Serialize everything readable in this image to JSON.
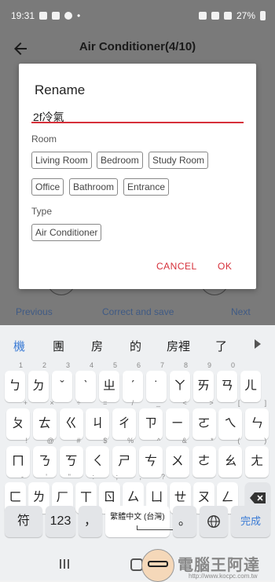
{
  "statusbar": {
    "time": "19:31",
    "battery": "27%"
  },
  "appbar": {
    "title": "Air Conditioner(4/10)"
  },
  "background_nav": {
    "previous": "Previous",
    "correct_save": "Correct and save",
    "next": "Next"
  },
  "dialog": {
    "title": "Rename",
    "input_value": "2f冷氣",
    "room_label": "Room",
    "rooms": [
      "Living Room",
      "Bedroom",
      "Study Room",
      "Office",
      "Bathroom",
      "Entrance"
    ],
    "type_label": "Type",
    "types": [
      "Air Conditioner"
    ],
    "cancel": "CANCEL",
    "ok": "OK"
  },
  "keyboard": {
    "candidates": [
      "機",
      "團",
      "房",
      "的",
      "房裡",
      "了"
    ],
    "row1": [
      {
        "k": "ㄅ",
        "h": "1"
      },
      {
        "k": "ㄉ",
        "h": "2"
      },
      {
        "k": "ˇ",
        "h": "3"
      },
      {
        "k": "ˋ",
        "h": "4"
      },
      {
        "k": "ㄓ",
        "h": "5"
      },
      {
        "k": "ˊ",
        "h": "6"
      },
      {
        "k": "˙",
        "h": "7"
      },
      {
        "k": "ㄚ",
        "h": "8"
      },
      {
        "k": "ㄞ",
        "h": "9"
      },
      {
        "k": "ㄢ",
        "h": "0"
      },
      {
        "k": "ㄦ",
        "h": ""
      }
    ],
    "row2": [
      {
        "k": "ㄆ",
        "h": "+"
      },
      {
        "k": "ㄊ",
        "h": "×"
      },
      {
        "k": "ㄍ",
        "h": "÷"
      },
      {
        "k": "ㄐ",
        "h": "="
      },
      {
        "k": "ㄔ",
        "h": "/"
      },
      {
        "k": "ㄗ",
        "h": "_"
      },
      {
        "k": "ㄧ",
        "h": "<"
      },
      {
        "k": "ㄛ",
        "h": ">"
      },
      {
        "k": "ㄟ",
        "h": "["
      },
      {
        "k": "ㄣ",
        "h": "]"
      }
    ],
    "row3": [
      {
        "k": "ㄇ",
        "h": "!"
      },
      {
        "k": "ㄋ",
        "h": "@"
      },
      {
        "k": "ㄎ",
        "h": "#"
      },
      {
        "k": "ㄑ",
        "h": "$"
      },
      {
        "k": "ㄕ",
        "h": "%"
      },
      {
        "k": "ㄘ",
        "h": "^"
      },
      {
        "k": "ㄨ",
        "h": "&"
      },
      {
        "k": "ㄜ",
        "h": "*"
      },
      {
        "k": "ㄠ",
        "h": "("
      },
      {
        "k": "ㄤ",
        "h": ")"
      }
    ],
    "row4": [
      {
        "k": "ㄈ",
        "h": "-"
      },
      {
        "k": "ㄌ",
        "h": "'"
      },
      {
        "k": "ㄏ",
        "h": "\""
      },
      {
        "k": "ㄒ",
        "h": ":"
      },
      {
        "k": "ㄖ",
        "h": ";"
      },
      {
        "k": "ㄙ",
        "h": ","
      },
      {
        "k": "ㄩ",
        "h": "?"
      },
      {
        "k": "ㄝ",
        "h": ""
      },
      {
        "k": "ㄡ",
        "h": ""
      },
      {
        "k": "ㄥ",
        "h": ""
      }
    ],
    "symbol_key": "符",
    "num_key": "123",
    "comma_key": "，",
    "space_label": "繁體中文 (台灣)",
    "period_key": "。",
    "done_key": "完成"
  },
  "watermark": {
    "text": "電腦王阿達",
    "url": "http://www.kocpc.com.tw"
  },
  "colors": {
    "accent_red": "#d6303a",
    "candidate_blue": "#3a7bd5",
    "overlay_gray": "#7a7a7a"
  }
}
